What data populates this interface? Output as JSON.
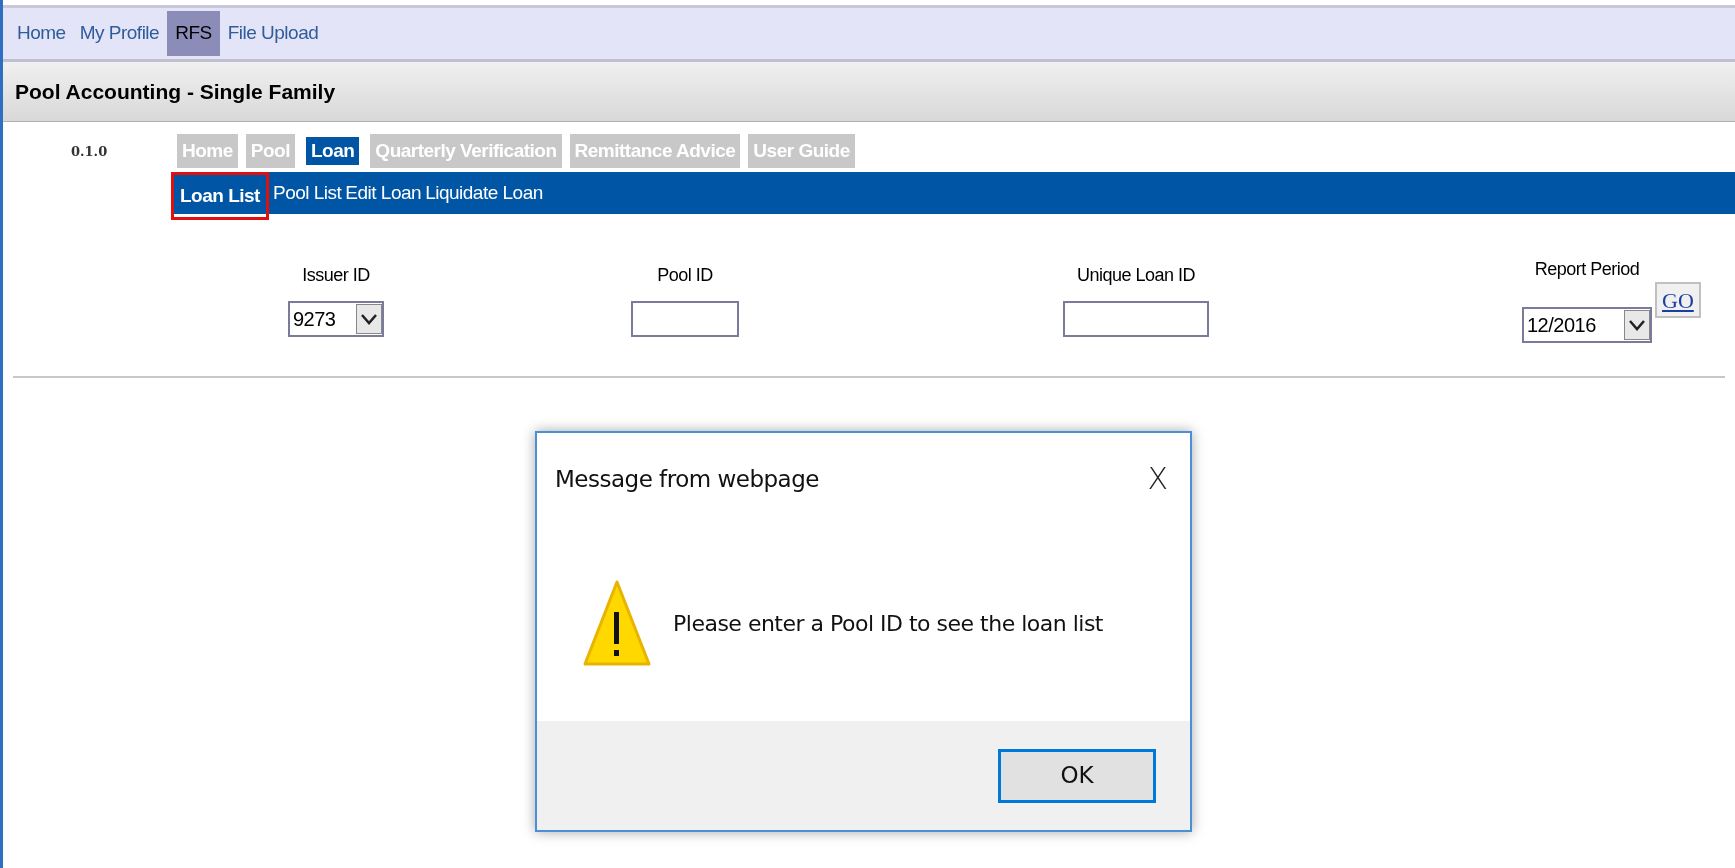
{
  "top_nav": [
    {
      "label": "Home",
      "selected": false
    },
    {
      "label": "My Profile",
      "selected": false
    },
    {
      "label": "RFS",
      "selected": true
    },
    {
      "label": "File Upload",
      "selected": false
    }
  ],
  "title": "Pool Accounting - Single Family",
  "version": "0.1.0",
  "tabs": [
    {
      "label": "Home",
      "selected": false
    },
    {
      "label": "Pool",
      "selected": false
    },
    {
      "label": "Loan",
      "selected": true
    },
    {
      "label": "Quarterly Verification",
      "selected": false
    },
    {
      "label": "Remittance Advice",
      "selected": false
    },
    {
      "label": "User Guide",
      "selected": false
    }
  ],
  "sub_nav": [
    {
      "label": "Loan List",
      "selected": true
    },
    {
      "label": "Pool List",
      "selected": false
    },
    {
      "label": "Edit Loan",
      "selected": false
    },
    {
      "label": "Liquidate Loan",
      "selected": false
    }
  ],
  "filters": [
    {
      "kind": "select",
      "label": "Issuer ID",
      "value": "9273"
    },
    {
      "kind": "input",
      "label": "Pool ID"
    },
    {
      "kind": "input",
      "label": "Unique Loan ID"
    },
    {
      "kind": "select",
      "label": "Report Period",
      "value": "12/2016"
    }
  ],
  "go_button": "GO",
  "dialog": {
    "title": "Message from webpage",
    "close": "X",
    "message": "Please enter a Pool ID to see the loan list",
    "ok_button": "OK"
  }
}
